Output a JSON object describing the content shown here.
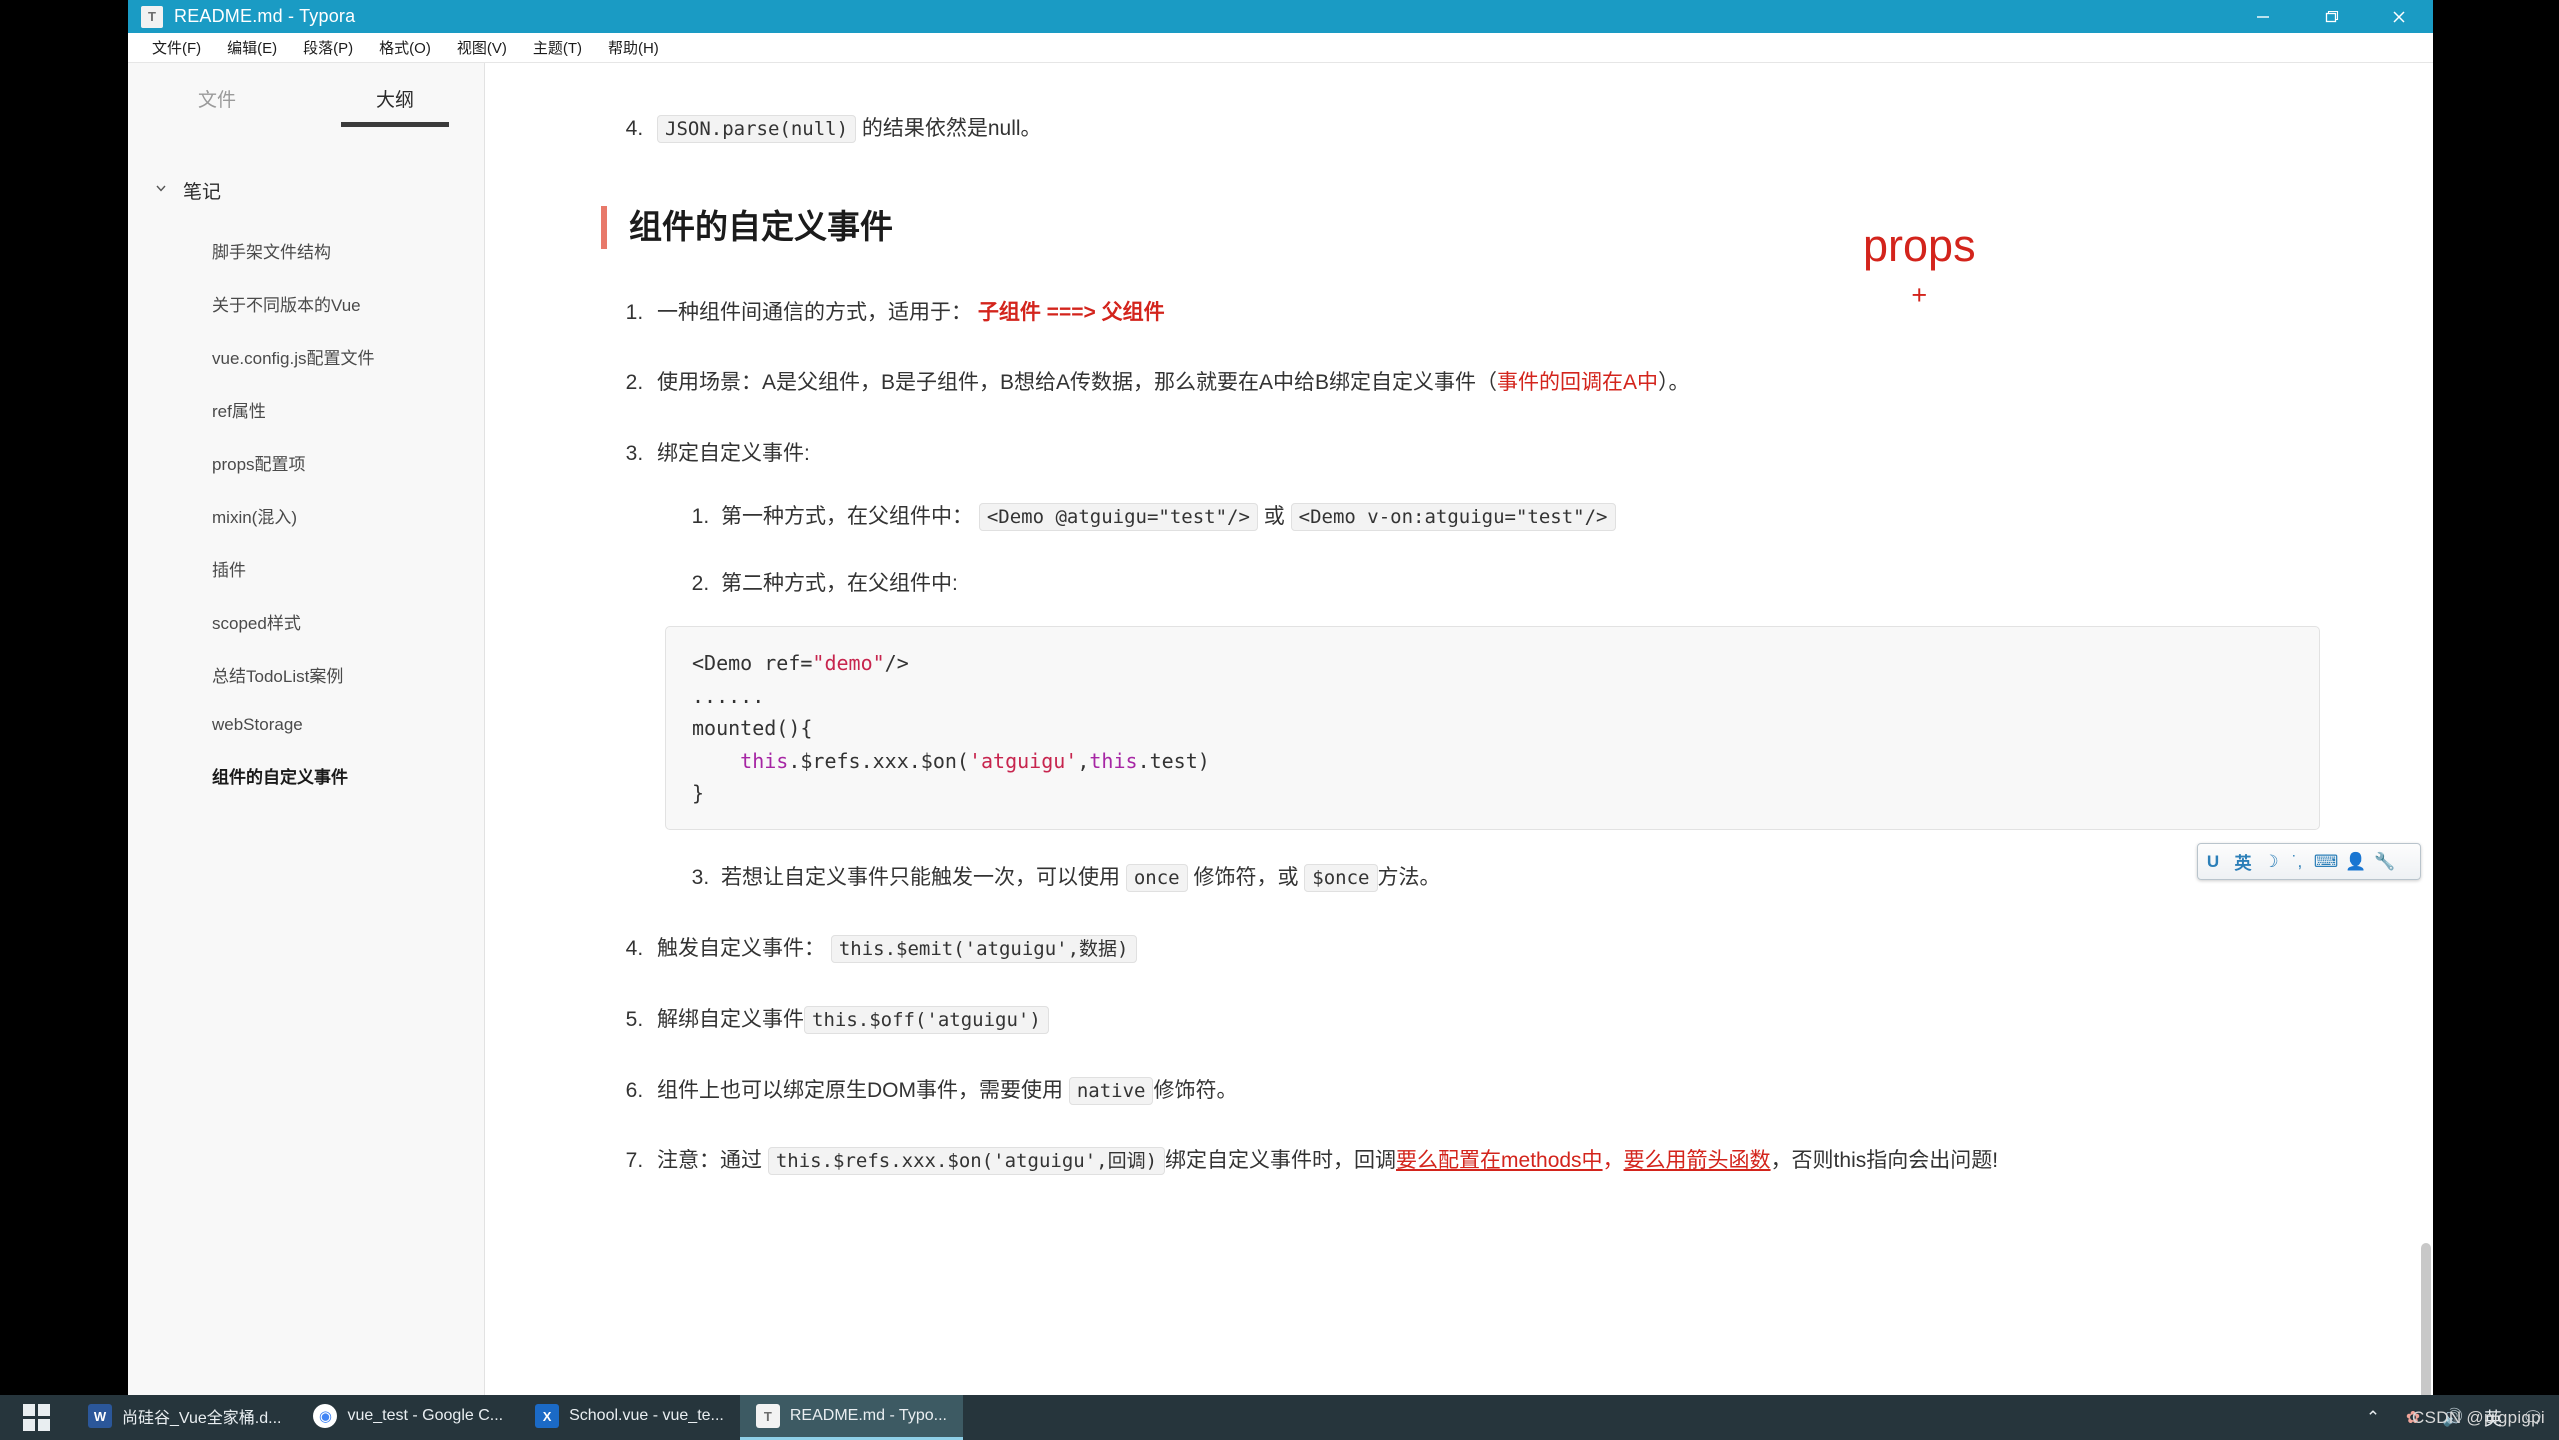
{
  "window": {
    "title": "README.md - Typora",
    "icon": "typora-icon",
    "icon_letter": "T",
    "controls": {
      "minimize": "minimize-icon",
      "maximize": "maximize-icon",
      "close": "close-icon"
    }
  },
  "menubar": {
    "items": [
      {
        "label": "文件(F)",
        "name": "menu-file"
      },
      {
        "label": "编辑(E)",
        "name": "menu-edit"
      },
      {
        "label": "段落(P)",
        "name": "menu-paragraph"
      },
      {
        "label": "格式(O)",
        "name": "menu-format"
      },
      {
        "label": "视图(V)",
        "name": "menu-view"
      },
      {
        "label": "主题(T)",
        "name": "menu-theme"
      },
      {
        "label": "帮助(H)",
        "name": "menu-help"
      }
    ]
  },
  "sidebar": {
    "tabs": [
      {
        "label": "文件",
        "active": false
      },
      {
        "label": "大纲",
        "active": true
      }
    ],
    "root": {
      "label": "笔记",
      "chevron": "chevron-down-icon",
      "expanded": true
    },
    "items": [
      {
        "label": "脚手架文件结构",
        "active": false
      },
      {
        "label": "关于不同版本的Vue",
        "active": false
      },
      {
        "label": "vue.config.js配置文件",
        "active": false
      },
      {
        "label": "ref属性",
        "active": false
      },
      {
        "label": "props配置项",
        "active": false
      },
      {
        "label": "mixin(混入)",
        "active": false
      },
      {
        "label": "插件",
        "active": false
      },
      {
        "label": "scoped样式",
        "active": false
      },
      {
        "label": "总结TodoList案例",
        "active": false
      },
      {
        "label": "webStorage",
        "active": false
      },
      {
        "label": "组件的自定义事件",
        "active": true
      }
    ]
  },
  "document": {
    "prev_item": {
      "number": "4.",
      "code": "JSON.parse(null)",
      "tail": " 的结果依然是null。"
    },
    "heading": "组件的自定义事件",
    "overlay": {
      "text": "props",
      "plus": "+",
      "color": "#d3241c"
    },
    "list": [
      {
        "n": 1,
        "text_before": "一种组件间通信的方式，适用于：",
        "red_bold": "子组件 ===> 父组件"
      },
      {
        "n": 2,
        "text_before": "使用场景：A是父组件，B是子组件，B想给A传数据，那么就要在A中给B绑定自定义事件（",
        "red": "事件的回调在A中",
        "text_after": "）。"
      },
      {
        "n": 3,
        "text_before": "绑定自定义事件:",
        "sub": [
          {
            "n": 1,
            "text_before": "第一种方式，在父组件中：",
            "code1": "<Demo @atguigu=\"test\"/>",
            "mid": "或",
            "code2": "<Demo v-on:atguigu=\"test\"/>"
          },
          {
            "n": 2,
            "text_before": "第二种方式，在父组件中:",
            "codeblock": [
              {
                "parts": [
                  {
                    "t": "<Demo ref=",
                    "c": "tag"
                  },
                  {
                    "t": "\"demo\"",
                    "c": "str"
                  },
                  {
                    "t": "/>",
                    "c": "tag"
                  }
                ]
              },
              {
                "parts": [
                  {
                    "t": "......",
                    "c": "tag"
                  }
                ]
              },
              {
                "parts": [
                  {
                    "t": "mounted(){",
                    "c": "tag"
                  }
                ]
              },
              {
                "parts": [
                  {
                    "t": "    ",
                    "c": "tag"
                  },
                  {
                    "t": "this",
                    "c": "kw"
                  },
                  {
                    "t": ".$refs.xxx.$on(",
                    "c": "tag"
                  },
                  {
                    "t": "'atguigu'",
                    "c": "str"
                  },
                  {
                    "t": ",",
                    "c": "tag"
                  },
                  {
                    "t": "this",
                    "c": "kw"
                  },
                  {
                    "t": ".test)",
                    "c": "tag"
                  }
                ]
              },
              {
                "parts": [
                  {
                    "t": "}",
                    "c": "tag"
                  }
                ]
              }
            ]
          },
          {
            "n": 3,
            "text_before": "若想让自定义事件只能触发一次，可以使用",
            "code1": "once",
            "mid": "修饰符，或",
            "code2": "$once",
            "text_after": "方法。"
          }
        ]
      },
      {
        "n": 4,
        "text_before": "触发自定义事件：",
        "code1": "this.$emit('atguigu',数据)"
      },
      {
        "n": 5,
        "text_before": "解绑自定义事件",
        "code1": "this.$off('atguigu')"
      },
      {
        "n": 6,
        "text_before": "组件上也可以绑定原生DOM事件，需要使用",
        "code1": "native",
        "text_after": "修饰符。"
      },
      {
        "n": 7,
        "text_before": "注意：通过",
        "code1": "this.$refs.xxx.$on('atguigu',回调)",
        "mid": "绑定自定义事件时，回调",
        "red_u1": "要么配置在methods中",
        "sep": "，",
        "red_u2": "要么用箭头函数",
        "text_after": "，否则this指向会出问题!"
      }
    ]
  },
  "ime_bar": {
    "icons": [
      {
        "name": "sogou-logo-icon",
        "glyph": "U"
      },
      {
        "name": "ime-language-icon",
        "glyph": "英"
      },
      {
        "name": "ime-moon-icon",
        "glyph": "☽"
      },
      {
        "name": "ime-punctuation-icon",
        "glyph": "˙,"
      },
      {
        "name": "ime-keyboard-icon",
        "glyph": "⌨"
      },
      {
        "name": "ime-user-icon",
        "glyph": "👤"
      },
      {
        "name": "ime-toolbox-icon",
        "glyph": "🔧"
      }
    ]
  },
  "taskbar": {
    "start": {
      "name": "start-button",
      "icon": "windows-logo-icon"
    },
    "items": [
      {
        "label": "尚硅谷_Vue全家桶.d...",
        "icon": "word-icon",
        "icon_letter": "W",
        "type": "word",
        "active": false
      },
      {
        "label": "vue_test - Google C...",
        "icon": "chrome-icon",
        "icon_letter": "◉",
        "type": "chrome",
        "active": false
      },
      {
        "label": "School.vue - vue_te...",
        "icon": "vscode-icon",
        "icon_letter": "X",
        "type": "vs",
        "active": false
      },
      {
        "label": "README.md - Typo...",
        "icon": "typora-icon",
        "icon_letter": "T",
        "type": "typora",
        "active": true
      }
    ],
    "tray": [
      {
        "name": "show-hidden-icons-chevron",
        "glyph": "⌃"
      },
      {
        "name": "cloud-sync-icon",
        "glyph": "✿"
      },
      {
        "name": "volume-icon",
        "glyph": "🔊"
      },
      {
        "name": "input-language-icon",
        "glyph": "英"
      },
      {
        "name": "action-center-icon",
        "glyph": "🗨"
      }
    ]
  },
  "watermark": "CSDN @pigpigpi"
}
